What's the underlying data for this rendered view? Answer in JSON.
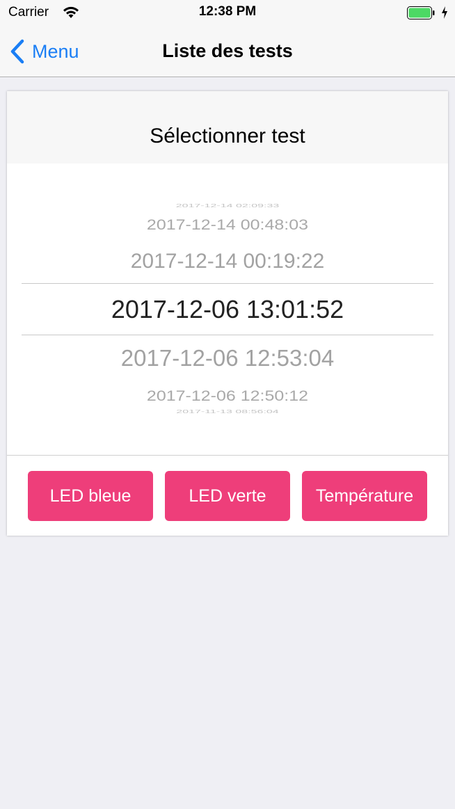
{
  "status_bar": {
    "carrier": "Carrier",
    "time": "12:38 PM",
    "battery_color": "#4cd964"
  },
  "nav": {
    "back_label": "Menu",
    "title": "Liste des tests",
    "accent_color": "#1a7ef5"
  },
  "card": {
    "title": "Sélectionner test",
    "picker": {
      "options_visible": [
        "2017-12-14 02:09:33",
        "2017-12-14 00:48:03",
        "2017-12-14 00:19:22",
        "2017-12-06 13:01:52",
        "2017-12-06 12:53:04",
        "2017-12-06 12:50:12",
        "2017-11-13 08:56:04"
      ],
      "selected_index": 3
    },
    "buttons": {
      "led_blue": "LED bleue",
      "led_green": "LED verte",
      "temperature": "Température",
      "color": "#ee3e7a"
    }
  }
}
